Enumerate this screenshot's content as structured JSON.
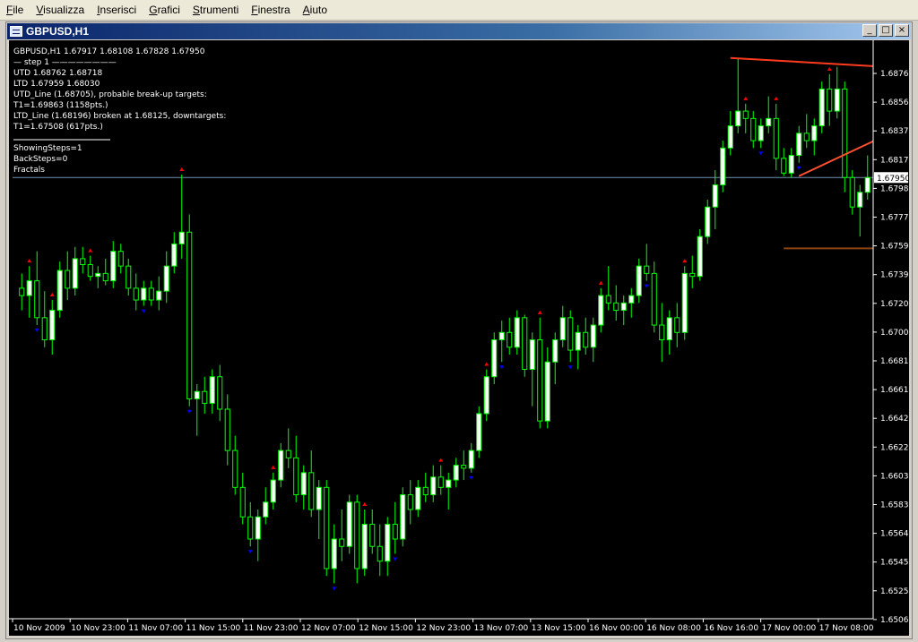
{
  "menu": [
    "File",
    "Visualizza",
    "Inserisci",
    "Grafici",
    "Strumenti",
    "Finestra",
    "Aiuto"
  ],
  "window": {
    "title": "GBPUSD,H1",
    "btn_min": "_",
    "btn_max": "□",
    "btn_close": "×"
  },
  "info_lines": [
    "GBPUSD,H1  1.67917 1.68108 1.67828 1.67950",
    "—    step 1    ————————",
    "UTD  1.68762  1.68718",
    "LTD  1.67959  1.68030",
    "UTD_Line (1.68705), probable break-up targets:",
    "T1=1.69863 (1158pts.)",
    "LTD_Line (1.68196) broken at 1.68125, downtargets:",
    "T1=1.67508 (617pts.)",
    "ShowingSteps=1",
    "BackSteps=0",
    "Fractals"
  ],
  "price_labels": [
    "1.68760",
    "1.68565",
    "1.68370",
    "1.68175",
    "1.67980",
    "1.67775",
    "1.67590",
    "1.67395",
    "1.67200",
    "1.67005",
    "1.66810",
    "1.66615",
    "1.66420",
    "1.66225",
    "1.66030",
    "1.65835",
    "1.65645",
    "1.65450",
    "1.65255",
    "1.65060"
  ],
  "current_price": "1.67950",
  "time_labels": [
    "10 Nov 2009",
    "10 Nov 23:00",
    "11 Nov 07:00",
    "11 Nov 15:00",
    "11 Nov 23:00",
    "12 Nov 07:00",
    "12 Nov 15:00",
    "12 Nov 23:00",
    "13 Nov 07:00",
    "13 Nov 15:00",
    "16 Nov 00:00",
    "16 Nov 08:00",
    "16 Nov 16:00",
    "17 Nov 00:00",
    "17 Nov 08:00"
  ],
  "colors": {
    "bull": "#ffffff",
    "bear": "#00ff00",
    "wick": "#00ff00",
    "fractal_up": "#ff0000",
    "fractal_down": "#0000ff",
    "hline": "#6f8faf",
    "utd": "#ff3b1f",
    "ltd": "#ff5030",
    "target": "#8b4513"
  },
  "chart_data": {
    "type": "candlestick",
    "symbol": "GBPUSD",
    "timeframe": "H1",
    "ylim": [
      1.6496,
      1.6888
    ],
    "current_bid": 1.6795,
    "candles": [
      [
        1.672,
        1.673,
        1.6705,
        1.6715
      ],
      [
        1.6715,
        1.6735,
        1.67,
        1.6725
      ],
      [
        1.6725,
        1.6745,
        1.6695,
        1.67
      ],
      [
        1.67,
        1.6718,
        1.668,
        1.6685
      ],
      [
        1.6685,
        1.6712,
        1.6675,
        1.6705
      ],
      [
        1.6705,
        1.6738,
        1.67,
        1.6732
      ],
      [
        1.6732,
        1.6745,
        1.6712,
        1.672
      ],
      [
        1.672,
        1.6748,
        1.6715,
        1.674
      ],
      [
        1.674,
        1.6748,
        1.673,
        1.6736
      ],
      [
        1.6736,
        1.6742,
        1.6725,
        1.6728
      ],
      [
        1.6728,
        1.6735,
        1.672,
        1.673
      ],
      [
        1.673,
        1.674,
        1.6722,
        1.6725
      ],
      [
        1.6725,
        1.6752,
        1.672,
        1.6745
      ],
      [
        1.6745,
        1.675,
        1.673,
        1.6735
      ],
      [
        1.6735,
        1.674,
        1.6715,
        1.672
      ],
      [
        1.672,
        1.673,
        1.6705,
        1.6712
      ],
      [
        1.6712,
        1.6725,
        1.6708,
        1.672
      ],
      [
        1.672,
        1.6725,
        1.6708,
        1.6712
      ],
      [
        1.6712,
        1.6728,
        1.6705,
        1.6718
      ],
      [
        1.6718,
        1.6745,
        1.671,
        1.6735
      ],
      [
        1.6735,
        1.6758,
        1.673,
        1.675
      ],
      [
        1.675,
        1.6797,
        1.674,
        1.6758
      ],
      [
        1.6758,
        1.677,
        1.664,
        1.6645
      ],
      [
        1.6645,
        1.6655,
        1.662,
        1.665
      ],
      [
        1.665,
        1.666,
        1.6635,
        1.6642
      ],
      [
        1.6642,
        1.6665,
        1.6635,
        1.666
      ],
      [
        1.666,
        1.6668,
        1.663,
        1.6638
      ],
      [
        1.6638,
        1.6648,
        1.66,
        1.661
      ],
      [
        1.661,
        1.662,
        1.658,
        1.6585
      ],
      [
        1.6585,
        1.6595,
        1.656,
        1.6565
      ],
      [
        1.6565,
        1.6575,
        1.6545,
        1.655
      ],
      [
        1.655,
        1.657,
        1.6535,
        1.6565
      ],
      [
        1.6565,
        1.6585,
        1.656,
        1.6575
      ],
      [
        1.6575,
        1.6595,
        1.657,
        1.659
      ],
      [
        1.659,
        1.6615,
        1.6585,
        1.661
      ],
      [
        1.661,
        1.6625,
        1.6598,
        1.6605
      ],
      [
        1.6605,
        1.662,
        1.6575,
        1.658
      ],
      [
        1.658,
        1.66,
        1.657,
        1.6595
      ],
      [
        1.6595,
        1.661,
        1.6565,
        1.657
      ],
      [
        1.657,
        1.659,
        1.655,
        1.6585
      ],
      [
        1.6585,
        1.659,
        1.6525,
        1.653
      ],
      [
        1.653,
        1.656,
        1.652,
        1.655
      ],
      [
        1.655,
        1.657,
        1.6535,
        1.6545
      ],
      [
        1.6545,
        1.658,
        1.654,
        1.6575
      ],
      [
        1.6575,
        1.658,
        1.652,
        1.653
      ],
      [
        1.653,
        1.657,
        1.6525,
        1.656
      ],
      [
        1.656,
        1.657,
        1.654,
        1.6545
      ],
      [
        1.6545,
        1.656,
        1.6525,
        1.6535
      ],
      [
        1.6535,
        1.6565,
        1.6525,
        1.656
      ],
      [
        1.656,
        1.6575,
        1.654,
        1.655
      ],
      [
        1.655,
        1.6585,
        1.6545,
        1.658
      ],
      [
        1.658,
        1.659,
        1.656,
        1.657
      ],
      [
        1.657,
        1.659,
        1.6565,
        1.6585
      ],
      [
        1.6585,
        1.6595,
        1.6575,
        1.658
      ],
      [
        1.658,
        1.66,
        1.6575,
        1.6592
      ],
      [
        1.6592,
        1.66,
        1.658,
        1.6585
      ],
      [
        1.6585,
        1.6595,
        1.657,
        1.659
      ],
      [
        1.659,
        1.6605,
        1.6585,
        1.66
      ],
      [
        1.66,
        1.661,
        1.659,
        1.6598
      ],
      [
        1.6598,
        1.6615,
        1.6595,
        1.661
      ],
      [
        1.661,
        1.664,
        1.6605,
        1.6635
      ],
      [
        1.6635,
        1.6665,
        1.663,
        1.666
      ],
      [
        1.666,
        1.669,
        1.6655,
        1.6685
      ],
      [
        1.6685,
        1.6698,
        1.667,
        1.669
      ],
      [
        1.669,
        1.67,
        1.6675,
        1.668
      ],
      [
        1.668,
        1.6705,
        1.6675,
        1.67
      ],
      [
        1.67,
        1.6702,
        1.666,
        1.6665
      ],
      [
        1.6665,
        1.669,
        1.664,
        1.6685
      ],
      [
        1.6685,
        1.67,
        1.6625,
        1.663
      ],
      [
        1.663,
        1.668,
        1.6625,
        1.667
      ],
      [
        1.667,
        1.669,
        1.6655,
        1.6685
      ],
      [
        1.6685,
        1.6708,
        1.668,
        1.67
      ],
      [
        1.67,
        1.6705,
        1.667,
        1.6678
      ],
      [
        1.6678,
        1.6695,
        1.6665,
        1.669
      ],
      [
        1.669,
        1.67,
        1.6675,
        1.668
      ],
      [
        1.668,
        1.67,
        1.667,
        1.6695
      ],
      [
        1.6695,
        1.672,
        1.669,
        1.6715
      ],
      [
        1.6715,
        1.6735,
        1.6705,
        1.671
      ],
      [
        1.671,
        1.6722,
        1.6698,
        1.6705
      ],
      [
        1.6705,
        1.6715,
        1.6695,
        1.671
      ],
      [
        1.671,
        1.672,
        1.67,
        1.6715
      ],
      [
        1.6715,
        1.674,
        1.671,
        1.6735
      ],
      [
        1.6735,
        1.675,
        1.6725,
        1.673
      ],
      [
        1.673,
        1.6738,
        1.669,
        1.6695
      ],
      [
        1.6695,
        1.671,
        1.667,
        1.6685
      ],
      [
        1.6685,
        1.6705,
        1.6675,
        1.67
      ],
      [
        1.67,
        1.671,
        1.668,
        1.669
      ],
      [
        1.669,
        1.6735,
        1.6685,
        1.673
      ],
      [
        1.673,
        1.6742,
        1.672,
        1.6728
      ],
      [
        1.6728,
        1.676,
        1.6725,
        1.6755
      ],
      [
        1.6755,
        1.678,
        1.675,
        1.6775
      ],
      [
        1.6775,
        1.68,
        1.676,
        1.679
      ],
      [
        1.679,
        1.682,
        1.6785,
        1.6815
      ],
      [
        1.6815,
        1.684,
        1.681,
        1.683
      ],
      [
        1.683,
        1.6876,
        1.6825,
        1.684
      ],
      [
        1.684,
        1.6845,
        1.6825,
        1.6835
      ],
      [
        1.6835,
        1.684,
        1.6815,
        1.682
      ],
      [
        1.682,
        1.6835,
        1.6815,
        1.683
      ],
      [
        1.683,
        1.685,
        1.6825,
        1.6835
      ],
      [
        1.6835,
        1.6845,
        1.68,
        1.6808
      ],
      [
        1.6808,
        1.6815,
        1.6796,
        1.6798
      ],
      [
        1.6798,
        1.6815,
        1.6795,
        1.681
      ],
      [
        1.681,
        1.683,
        1.6805,
        1.6825
      ],
      [
        1.6825,
        1.6838,
        1.6815,
        1.682
      ],
      [
        1.682,
        1.6835,
        1.681,
        1.683
      ],
      [
        1.683,
        1.686,
        1.6825,
        1.6855
      ],
      [
        1.6855,
        1.6865,
        1.683,
        1.684
      ],
      [
        1.684,
        1.687,
        1.6835,
        1.6855
      ],
      [
        1.6855,
        1.686,
        1.6785,
        1.6795
      ],
      [
        1.6795,
        1.68,
        1.677,
        1.6775
      ],
      [
        1.6775,
        1.679,
        1.6755,
        1.6785
      ],
      [
        1.6785,
        1.681,
        1.678,
        1.6795
      ]
    ],
    "fractals_up": [
      1,
      4,
      9,
      21,
      33,
      45,
      55,
      61,
      68,
      76,
      87,
      95,
      99,
      106
    ],
    "fractals_down": [
      2,
      16,
      22,
      30,
      41,
      49,
      59,
      63,
      72,
      82,
      97,
      102
    ],
    "utd_line": {
      "from_index": 93,
      "from_price": 1.6876,
      "to_price": 1.68705
    },
    "ltd_line": {
      "from_index": 102,
      "from_price": 1.6796,
      "to_price": 1.68196
    },
    "target_line": {
      "from_index": 100,
      "price": 1.6747
    }
  }
}
